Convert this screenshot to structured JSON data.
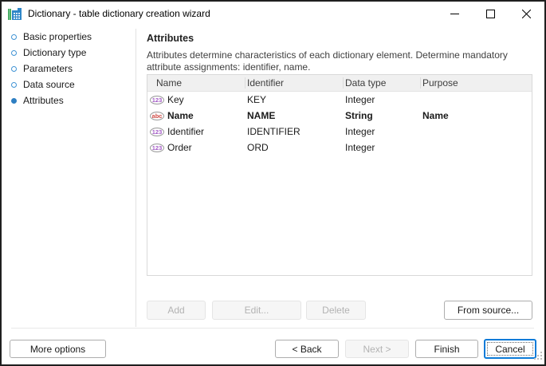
{
  "window": {
    "title": "Dictionary - table dictionary creation wizard",
    "icon": "dictionary-table-icon",
    "controls": {
      "minimize": "minimize-icon",
      "maximize": "maximize-icon",
      "close": "close-icon"
    }
  },
  "sidebar": {
    "items": [
      {
        "label": "Basic properties",
        "active": false
      },
      {
        "label": "Dictionary type",
        "active": false
      },
      {
        "label": "Parameters",
        "active": false
      },
      {
        "label": "Data source",
        "active": false
      },
      {
        "label": "Attributes",
        "active": true
      }
    ]
  },
  "main": {
    "heading": "Attributes",
    "description": "Attributes determine characteristics of each dictionary element. Determine mandatory attribute assignments: identifier, name.",
    "table": {
      "columns": [
        "Name",
        "Identifier",
        "Data type",
        "Purpose"
      ],
      "rows": [
        {
          "type_icon": "number-type-icon",
          "icon_text": "123",
          "name": "Key",
          "identifier": "KEY",
          "data_type": "Integer",
          "purpose": "",
          "emphasized": false
        },
        {
          "type_icon": "string-type-icon",
          "icon_text": "abc",
          "name": "Name",
          "identifier": "NAME",
          "data_type": "String",
          "purpose": "Name",
          "emphasized": true
        },
        {
          "type_icon": "number-type-icon",
          "icon_text": "123",
          "name": "Identifier",
          "identifier": "IDENTIFIER",
          "data_type": "Integer",
          "purpose": "",
          "emphasized": false
        },
        {
          "type_icon": "number-type-icon",
          "icon_text": "123",
          "name": "Order",
          "identifier": "ORD",
          "data_type": "Integer",
          "purpose": "",
          "emphasized": false
        }
      ]
    },
    "actions": {
      "add": {
        "label": "Add",
        "enabled": false
      },
      "edit": {
        "label": "Edit...",
        "enabled": false
      },
      "delete": {
        "label": "Delete",
        "enabled": false
      },
      "from_source": {
        "label": "From source...",
        "enabled": true
      }
    }
  },
  "footer": {
    "more_options": "More options",
    "back": {
      "label": "< Back",
      "enabled": true
    },
    "next": {
      "label": "Next >",
      "enabled": false
    },
    "finish": {
      "label": "Finish",
      "enabled": true
    },
    "cancel": {
      "label": "Cancel",
      "enabled": true,
      "focused": true
    }
  },
  "colors": {
    "accent": "#0c7bd8",
    "step_bullet": "#2e7fc2",
    "number_type": "#a35bc6",
    "string_type": "#cf4a45",
    "icon_green": "#3ba558",
    "icon_blue": "#2e86c8"
  }
}
